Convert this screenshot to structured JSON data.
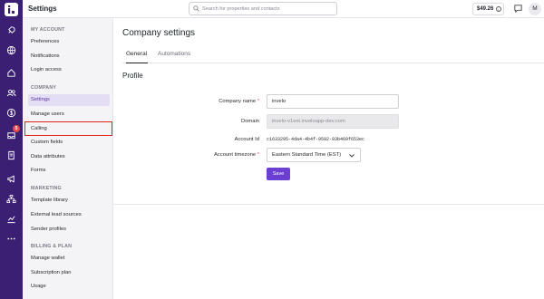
{
  "topbar": {
    "app_title": "Settings",
    "search_placeholder": "Search for properties and contacts",
    "wallet_amount": "$49.26",
    "avatar_initial": "M"
  },
  "rail": {
    "icons": [
      "rocket-icon",
      "globe-icon",
      "home-icon",
      "contacts-icon",
      "dollar-icon",
      "inbox-icon",
      "document-icon",
      "megaphone-icon",
      "org-chart-icon",
      "analytics-icon",
      "more-icon"
    ],
    "inbox_badge": "5",
    "brand_color": "#3a1f73"
  },
  "sidebar": {
    "sections": [
      {
        "title": "MY ACCOUNT",
        "items": [
          "Preferences",
          "Notifications",
          "Login access"
        ]
      },
      {
        "title": "COMPANY",
        "items": [
          "Settings",
          "Manage users",
          "Calling",
          "Custom fields",
          "Data attributes",
          "Forms"
        ]
      },
      {
        "title": "MARKETING",
        "items": [
          "Template library",
          "External lead sources",
          "Sender profiles"
        ]
      },
      {
        "title": "BILLING & PLAN",
        "items": [
          "Manage wallet",
          "Subscription plan",
          "Usage"
        ]
      }
    ],
    "active_item": "Settings",
    "highlighted_item": "Calling",
    "highlight_color": "#e1251b"
  },
  "main": {
    "page_title": "Company settings",
    "tabs": [
      "General",
      "Automations"
    ],
    "active_tab": "General",
    "section_title": "Profile",
    "fields": {
      "company_name": {
        "label": "Company name",
        "value": "invelo",
        "required": "*"
      },
      "domain": {
        "label": "Domain",
        "value": "invelo-v1est.inveloapp-dev.com"
      },
      "account_id": {
        "label": "Account Id",
        "value": "c1633295-4da4-4b4f-9592-93b469f653ec"
      },
      "timezone": {
        "label": "Account timezone",
        "value": "Eastern Standard Time (EST)",
        "required": "*"
      }
    },
    "save_label": "Save",
    "accent_color": "#6b3fd1"
  }
}
